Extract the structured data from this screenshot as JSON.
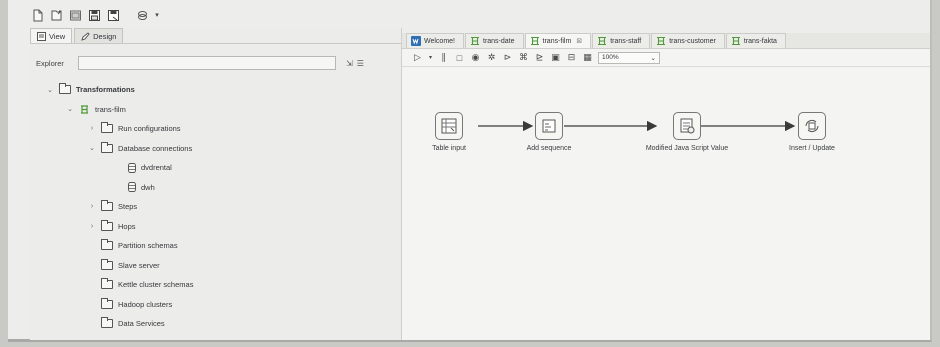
{
  "toolbar": {
    "buttons": [
      "new-file-icon",
      "open-icon",
      "explore-repository-icon",
      "save-icon",
      "save-as-icon",
      "perspective-icon"
    ]
  },
  "left_panel": {
    "tabs": [
      {
        "label": "View",
        "icon": "view-icon"
      },
      {
        "label": "Design",
        "icon": "pencil-icon"
      }
    ],
    "explorer_label": "Explorer",
    "explorer_value": "",
    "tree": [
      {
        "label": "Transformations",
        "bold": true
      },
      {
        "label": "trans-film"
      },
      {
        "label": "Run configurations"
      },
      {
        "label": "Database connections"
      },
      {
        "label": "dvdrental"
      },
      {
        "label": "dwh"
      },
      {
        "label": "Steps"
      },
      {
        "label": "Hops"
      },
      {
        "label": "Partition schemas"
      },
      {
        "label": "Slave server"
      },
      {
        "label": "Kettle cluster schemas"
      },
      {
        "label": "Hadoop clusters"
      },
      {
        "label": "Data Services"
      }
    ]
  },
  "editor": {
    "tabs": [
      {
        "label": "Welcome!"
      },
      {
        "label": "trans-date"
      },
      {
        "label": "trans-film"
      },
      {
        "label": "trans-staff"
      },
      {
        "label": "trans-customer"
      },
      {
        "label": "trans-fakta"
      }
    ],
    "zoom": "100%",
    "steps": [
      {
        "label": "Table input"
      },
      {
        "label": "Add sequence"
      },
      {
        "label": "Modified Java Script Value"
      },
      {
        "label": "Insert / Update"
      }
    ]
  },
  "colors": {
    "accent": "#2f6fb5",
    "transformation_green": "#4f9a3a",
    "background": "#ededeb"
  }
}
